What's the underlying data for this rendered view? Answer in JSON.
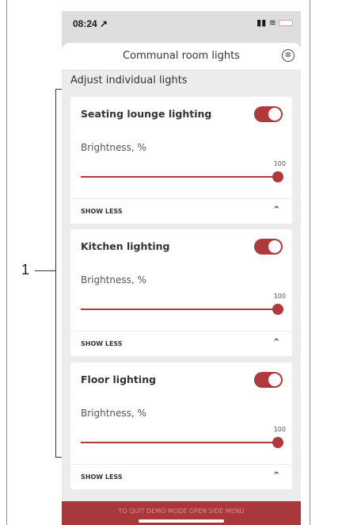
{
  "status_bar": {
    "time": "08:24 ↗",
    "icons": "▮▮ ≋"
  },
  "header": {
    "title": "Communal room lights",
    "close_icon": "⊗"
  },
  "section_title": "Adjust individual lights",
  "lights": [
    {
      "name": "Seating lounge lighting",
      "on": true,
      "brightness_label": "Brightness, %",
      "value": "100",
      "level_fraction": 1.0,
      "show_less": "SHOW LESS",
      "chevron": "^"
    },
    {
      "name": "Kitchen lighting",
      "on": true,
      "brightness_label": "Brightness, %",
      "value": "100",
      "level_fraction": 1.0,
      "show_less": "SHOW LESS",
      "chevron": "^"
    },
    {
      "name": "Floor lighting",
      "on": true,
      "brightness_label": "Brightness, %",
      "value": "100",
      "level_fraction": 1.0,
      "show_less": "SHOW LESS",
      "chevron": "^"
    }
  ],
  "bottom_bar": {
    "text": "TO QUIT DEMO MODE OPEN SIDE MENU"
  },
  "callout": {
    "label": "1"
  },
  "colors": {
    "accent": "#b0393b",
    "sheet_background": "#ececec",
    "bottom_bar": "#a8383a"
  }
}
